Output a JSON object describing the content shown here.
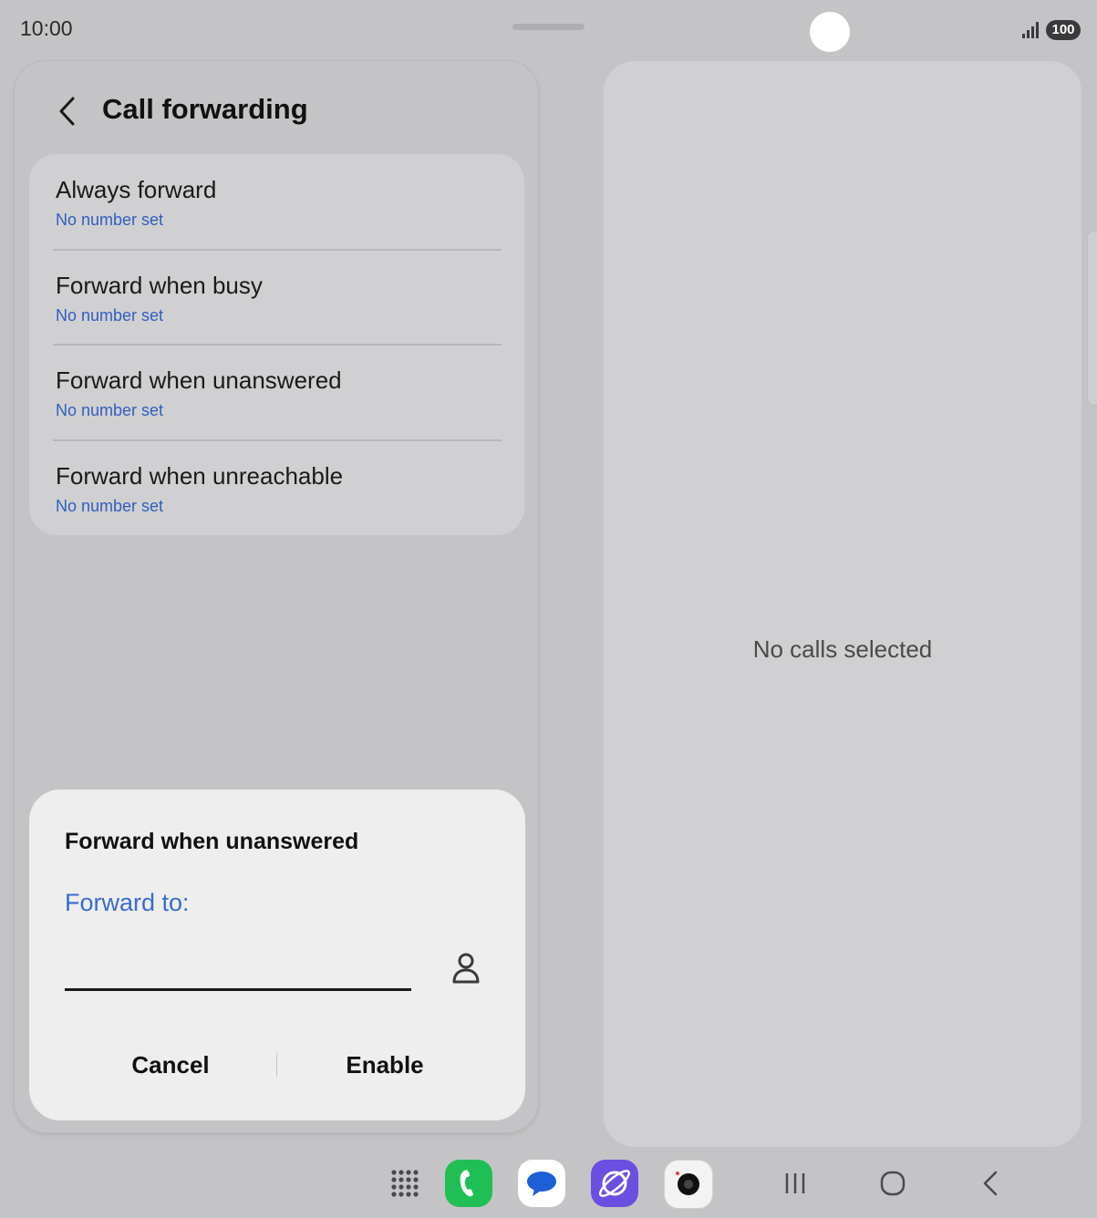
{
  "status_bar": {
    "time": "10:00",
    "battery": "100"
  },
  "header": {
    "title": "Call forwarding"
  },
  "forwarding_options": [
    {
      "title": "Always forward",
      "subtitle": "No number set"
    },
    {
      "title": "Forward when busy",
      "subtitle": "No number set"
    },
    {
      "title": "Forward when unanswered",
      "subtitle": "No number set"
    },
    {
      "title": "Forward when unreachable",
      "subtitle": "No number set"
    }
  ],
  "dialog": {
    "title": "Forward when unanswered",
    "field_label": "Forward to:",
    "field_value": "",
    "cancel_label": "Cancel",
    "enable_label": "Enable"
  },
  "detail_pane": {
    "empty_text": "No calls selected"
  },
  "taskbar": {
    "apps": [
      "app-grid-icon",
      "phone-app-icon",
      "messages-app-icon",
      "internet-app-icon",
      "camera-app-icon"
    ],
    "nav": [
      "recents-icon",
      "home-icon",
      "back-icon"
    ]
  },
  "colors": {
    "accent_blue": "#2f5fbf",
    "phone_green": "#1fbf55",
    "internet_purple": "#6a4fe0"
  }
}
